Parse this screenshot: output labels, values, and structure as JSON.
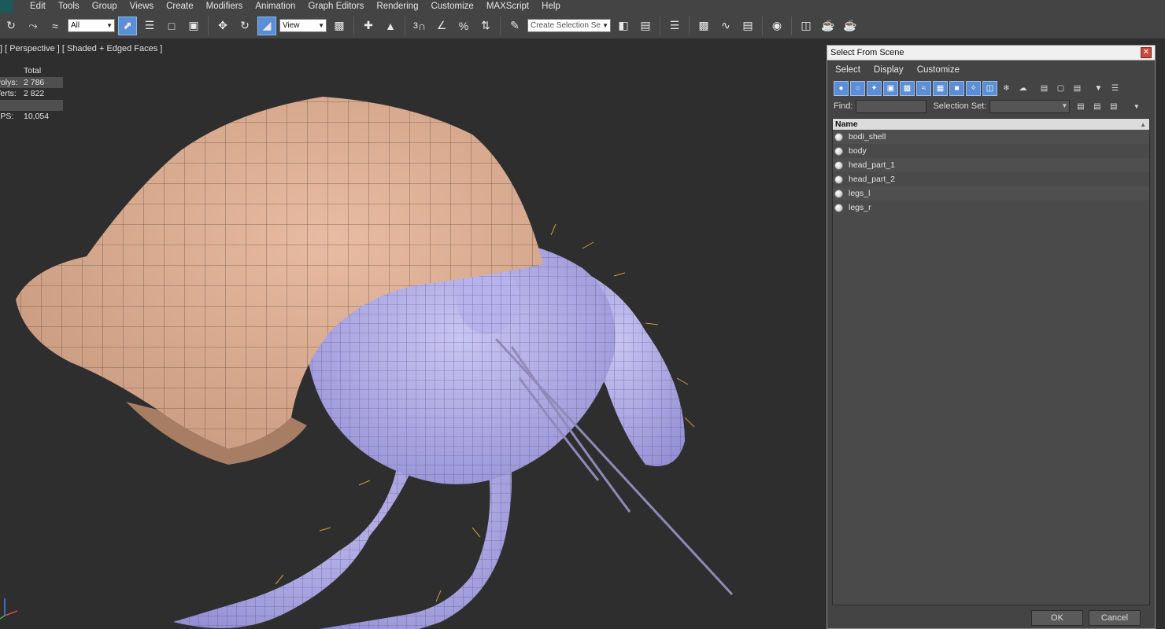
{
  "menu": [
    "Edit",
    "Tools",
    "Group",
    "Views",
    "Create",
    "Modifiers",
    "Animation",
    "Graph Editors",
    "Rendering",
    "Customize",
    "MAXScript",
    "Help"
  ],
  "toolbar": {
    "filter_value": "All",
    "coord_value": "View",
    "snap_label": "3",
    "selection_set_value": "Create Selection Se"
  },
  "viewport": {
    "label": "] [ Perspective ] [ Shaded + Edged Faces ]",
    "stats": {
      "total_label": "Total",
      "polys_label": "Polys:",
      "polys_value": "2 786",
      "verts_label": "Verts:",
      "verts_value": "2 822",
      "fps_label": "FPS:",
      "fps_value": "10,054"
    }
  },
  "dialog": {
    "title": "Select From Scene",
    "menu": [
      "Select",
      "Display",
      "Customize"
    ],
    "find_label": "Find:",
    "selection_set_label": "Selection Set:",
    "column_header": "Name",
    "objects": [
      "bodi_shell",
      "body",
      "head_part_1",
      "head_part_2",
      "legs_l",
      "legs_r"
    ],
    "ok_label": "OK",
    "cancel_label": "Cancel"
  },
  "colors": {
    "shell": "#d4a58a",
    "body": "#a9a4e2",
    "hair": "#c9a13a",
    "highlight": "#5b8ed6"
  }
}
